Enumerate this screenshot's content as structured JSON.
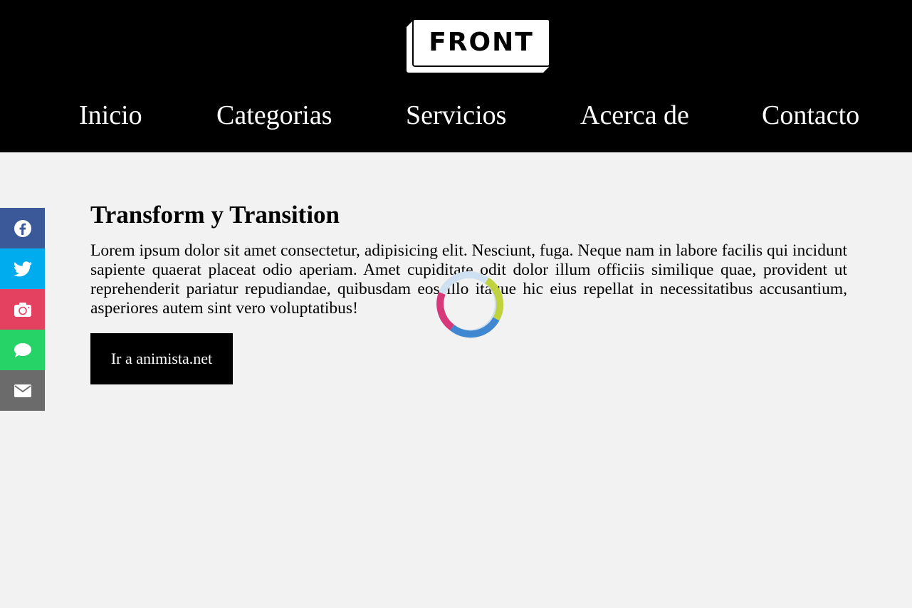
{
  "header": {
    "logo_text": "FRONT",
    "nav": [
      {
        "label": "Inicio"
      },
      {
        "label": "Categorias"
      },
      {
        "label": "Servicios"
      },
      {
        "label": "Acerca de"
      },
      {
        "label": "Contacto"
      }
    ]
  },
  "social": [
    {
      "icon": "facebook-icon",
      "color": "#3b5998"
    },
    {
      "icon": "twitter-icon",
      "color": "#00acee"
    },
    {
      "icon": "instagram-icon",
      "color": "#e4405f"
    },
    {
      "icon": "whatsapp-icon",
      "color": "#25d366"
    },
    {
      "icon": "email-icon",
      "color": "#6b6b6b"
    }
  ],
  "main": {
    "title": "Transform y Transition",
    "paragraph": "Lorem ipsum dolor sit amet consectetur, adipisicing elit. Nesciunt, fuga. Neque nam in labore facilis qui incidunt sapiente quaerat placeat odio aperiam. Amet cupiditate odit dolor illum officiis similique quae, provident ut reprehenderit pariatur repudiandae, quibusdam eos illo itaque hic eius repellat in necessitatibus accusantium, asperiores autem sint vero voluptatibus!",
    "button_label": "Ir a animista.net"
  },
  "spinner": {
    "colors": [
      "#c0d23e",
      "#3f87d0",
      "#d6397a",
      "#cfe0f0"
    ]
  }
}
